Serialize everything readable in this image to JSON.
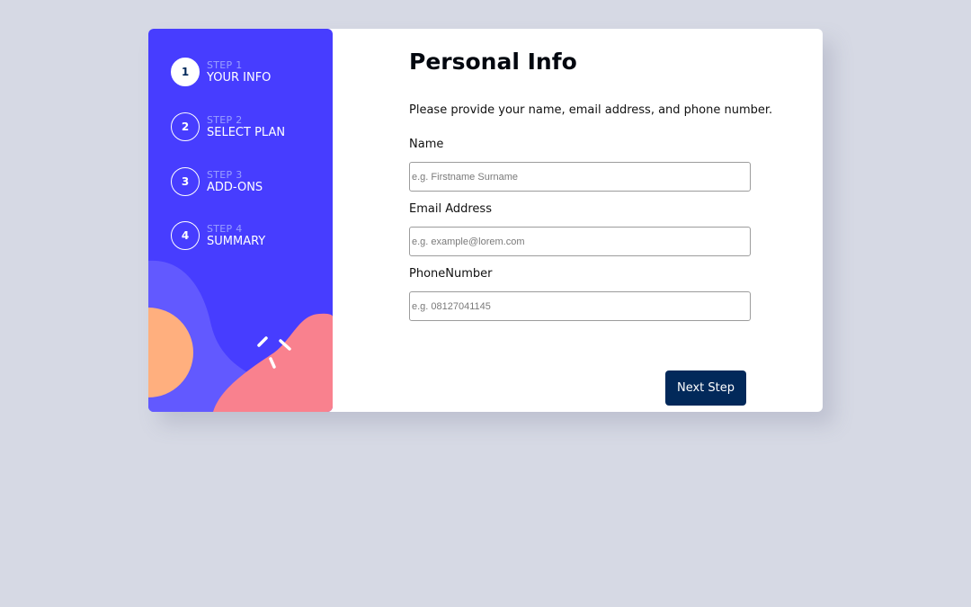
{
  "colors": {
    "page_background": "#d6d9e4",
    "sidebar": "#473dff",
    "button": "#02295a",
    "blob_purple": "#6259ff",
    "blob_orange": "#ffaf7e",
    "blob_pink": "#f9818e"
  },
  "sidebar": {
    "steps": [
      {
        "number": "1",
        "label": "STEP 1",
        "title": "YOUR INFO",
        "active": true
      },
      {
        "number": "2",
        "label": "STEP 2",
        "title": "SELECT PLAN",
        "active": false
      },
      {
        "number": "3",
        "label": "STEP 3",
        "title": "ADD-ONS",
        "active": false
      },
      {
        "number": "4",
        "label": "STEP 4",
        "title": "SUMMARY",
        "active": false
      }
    ]
  },
  "form": {
    "title": "Personal Info",
    "subtitle": "Please provide your name, email address, and phone number.",
    "fields": {
      "name": {
        "label": "Name",
        "placeholder": "e.g. Firstname Surname",
        "value": ""
      },
      "email": {
        "label": "Email Address",
        "placeholder": "e.g. example@lorem.com",
        "value": ""
      },
      "phone": {
        "label": "PhoneNumber",
        "placeholder": "e.g. 08127041145",
        "value": ""
      }
    },
    "next_label": "Next Step"
  }
}
